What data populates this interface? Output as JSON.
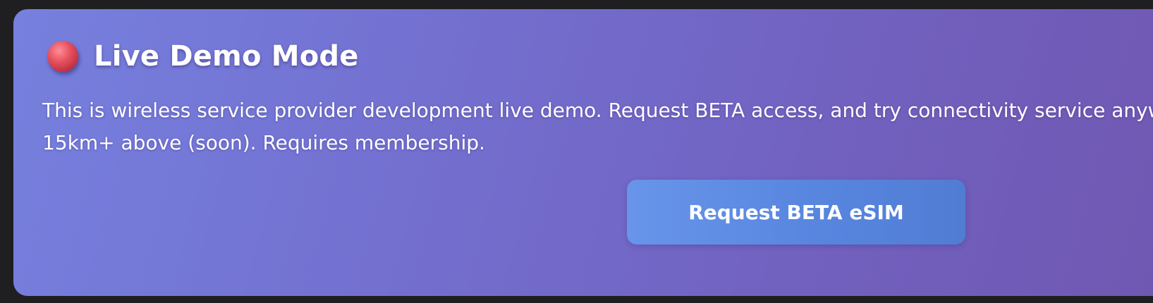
{
  "banner": {
    "title": "Live Demo Mode",
    "status_icon": "red-status-dot-icon",
    "description_line1": "This is wireless service provider development live demo. Request BETA access, and try connectivity service anywhe",
    "description_line2": "15km+ above (soon). Requires membership.",
    "button_label": "Request BETA eSIM"
  },
  "colors": {
    "page_background": "#1f1f21",
    "card_gradient_start": "#7680de",
    "card_gradient_end": "#6f58b2",
    "button_background": "#5886df",
    "status_dot": "#e6505e",
    "text": "#ffffff"
  }
}
